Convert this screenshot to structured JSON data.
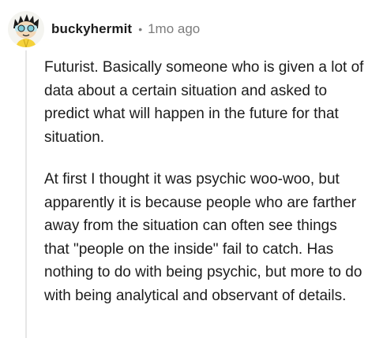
{
  "comment": {
    "username": "buckyhermit",
    "separator": "•",
    "timestamp": "1mo ago",
    "paragraphs": [
      "Futurist. Basically someone who is given a lot of data about a certain situation and asked to predict what will happen in the future for that situation.",
      "At first I thought it was psychic woo-woo, but apparently it is because people who are farther away from the situation can often see things that \"people on the inside\" fail to catch. Has nothing to do with being psychic, but more to do with being analytical and observant of details."
    ]
  },
  "colors": {
    "text": "#1c1c1c",
    "meta": "#7c7c7c",
    "thread_line": "#e6e6e6"
  }
}
